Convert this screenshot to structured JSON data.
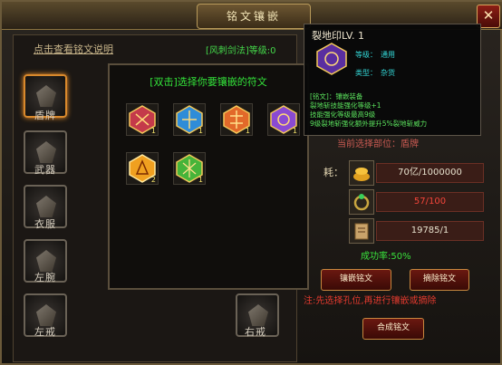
{
  "window": {
    "title": "铭文镶嵌",
    "close": "✕"
  },
  "left": {
    "help_link": "点击查看铭文说明",
    "level_info": "[风刺剑法]等级:0",
    "slots": [
      {
        "label": "盾牌"
      },
      {
        "label": "武器"
      },
      {
        "label": "衣服"
      },
      {
        "label": "左腕"
      },
      {
        "label": "左戒"
      },
      {
        "label": "右戒"
      }
    ]
  },
  "popup": {
    "title": "[双击]选择你要镶嵌的符文",
    "gems": [
      {
        "color": "#c43a4a",
        "count": "1"
      },
      {
        "color": "#2f8cd8",
        "count": "1"
      },
      {
        "color": "#e2692a",
        "count": "1"
      },
      {
        "color": "#8a4ad2",
        "count": "1"
      },
      {
        "color": "#f0a020",
        "count": "2"
      },
      {
        "color": "#46b43a",
        "count": "1"
      }
    ]
  },
  "tooltip": {
    "name": "裂地印LV. 1",
    "grade_label": "等级：",
    "grade_value": "通用",
    "type_label": "类型：",
    "type_value": "杂货",
    "lines": [
      "[铭文]：镶嵌装备",
      "裂地斩技能强化等级+1",
      "技能强化等级最高9级",
      "9级裂地斩强化额外提升5%裂地斩威力"
    ]
  },
  "right": {
    "current_slot": "当前选择部位：盾牌",
    "cost_label": "耗：",
    "cost_gold": "70亿/1000000",
    "cost_item": "57/100",
    "cost_book": "19785/1",
    "success_rate": "成功率:50%",
    "btn_inlay": "镶嵌铭文",
    "btn_remove": "摘除铭文",
    "note": "注:先选择孔位,再进行镶嵌或摘除",
    "btn_compose": "合成铭文"
  }
}
